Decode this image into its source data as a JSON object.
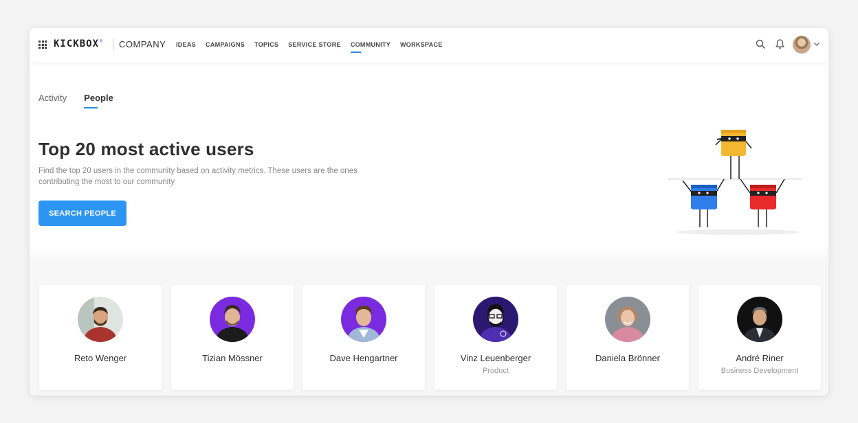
{
  "header": {
    "logo": "KICKBOX",
    "logo_mark": "®",
    "company": "COMPANY",
    "nav": [
      {
        "label": "IDEAS"
      },
      {
        "label": "CAMPAIGNS"
      },
      {
        "label": "TOPICS"
      },
      {
        "label": "SERVICE STORE"
      },
      {
        "label": "COMMUNITY",
        "active": true
      },
      {
        "label": "WORKSPACE"
      }
    ],
    "icons": [
      "grid-icon",
      "search-icon",
      "bell-icon",
      "avatar",
      "chevron-down-icon"
    ]
  },
  "tabs": [
    {
      "label": "Activity"
    },
    {
      "label": "People",
      "active": true
    }
  ],
  "hero": {
    "title": "Top 20 most active users",
    "description": "Find the top 20 users in the community based on activity metrics. These users are the ones contributing the most to our community",
    "button": "SEARCH PEOPLE"
  },
  "people": [
    {
      "name": "Reto Wenger",
      "role": ""
    },
    {
      "name": "Tizian Mössner",
      "role": ""
    },
    {
      "name": "Dave Hengartner",
      "role": ""
    },
    {
      "name": "Vinz Leuenberger",
      "role": "Product"
    },
    {
      "name": "Daniela Brönner",
      "role": ""
    },
    {
      "name": "André Riner",
      "role": "Business Development"
    }
  ],
  "colors": {
    "accent": "#2c95f2",
    "purple": "#7a2be0",
    "text": "#2f2f2f"
  }
}
